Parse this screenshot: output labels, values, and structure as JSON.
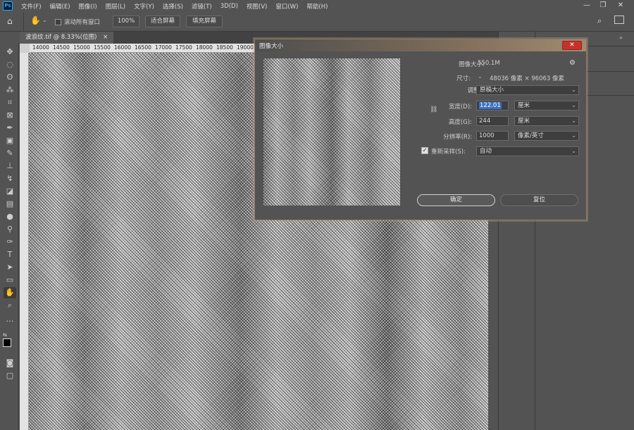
{
  "menubar": {
    "app_logo": "Ps",
    "items": [
      "文件(F)",
      "编辑(E)",
      "图像(I)",
      "图层(L)",
      "文字(Y)",
      "选择(S)",
      "滤镜(T)",
      "3D(D)",
      "视图(V)",
      "窗口(W)",
      "帮助(H)"
    ]
  },
  "options_bar": {
    "scroll_all_label": "滚动所有窗口",
    "zoom_button": "100%",
    "fit_screen": "适合屏幕",
    "fill_screen": "填充屏幕"
  },
  "document": {
    "tab_title": "波浪纹.tif @ 8.33%(位图)",
    "tab_close": "×"
  },
  "ruler": {
    "h_labels": [
      "14000",
      "14500",
      "15000",
      "15500",
      "16000",
      "16500",
      "17000",
      "17500",
      "18000",
      "18500",
      "19000"
    ]
  },
  "dialog": {
    "title": "图像大小",
    "close": "✕",
    "image_size_label": "图像大小:",
    "image_size_value": "550.1M",
    "dimensions_label": "尺寸:",
    "dimensions_value": "48036 像素 × 96063 像素",
    "fit_to_label": "调整为:",
    "fit_to_value": "原稿大小",
    "width_label": "宽度(D):",
    "width_value": "122.01",
    "width_unit": "厘米",
    "height_label": "高度(G):",
    "height_value": "244",
    "height_unit": "厘米",
    "resolution_label": "分辨率(R):",
    "resolution_value": "1000",
    "resolution_unit": "像素/英寸",
    "resample_label": "重新采样(S):",
    "resample_value": "自动",
    "ok_button": "确定",
    "reset_button": "复位"
  }
}
